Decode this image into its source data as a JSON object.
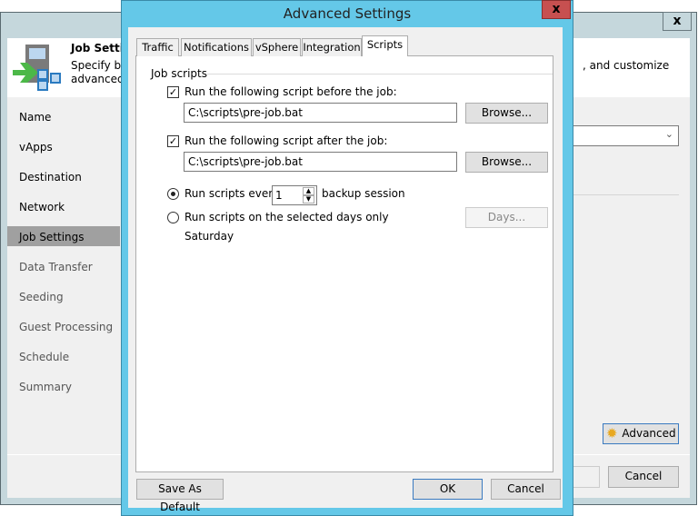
{
  "background_window": {
    "close_label": "x",
    "header_title": "Job Settings",
    "header_desc_line1": "Specify ba",
    "header_desc_line2": "advanced",
    "header_desc_right": ", and customize",
    "nav": [
      "Name",
      "vApps",
      "Destination",
      "Network",
      "Job Settings",
      "Data Transfer",
      "Seeding",
      "Guest Processing",
      "Schedule",
      "Summary"
    ],
    "advanced_label": "Advanced",
    "cancel_label": "Cancel"
  },
  "dialog": {
    "title": "Advanced Settings",
    "close_label": "x",
    "tabs": [
      "Traffic",
      "Notifications",
      "vSphere",
      "Integration",
      "Scripts"
    ],
    "active_tab": "Scripts",
    "group_label": "Job scripts",
    "before_label": "Run the following script before the job:",
    "before_checked": true,
    "before_path": "C:\\scripts\\pre-job.bat",
    "after_label": "Run the following script after the job:",
    "after_checked": true,
    "after_path": "C:\\scripts\\pre-job.bat",
    "browse_label": "Browse...",
    "every_label": "Run scripts every",
    "every_value": "1",
    "every_suffix": "backup session",
    "days_label": "Run scripts on the selected days only",
    "days_button": "Days...",
    "selected_days": "Saturday",
    "save_default": "Save As Default",
    "ok": "OK",
    "cancel": "Cancel"
  }
}
